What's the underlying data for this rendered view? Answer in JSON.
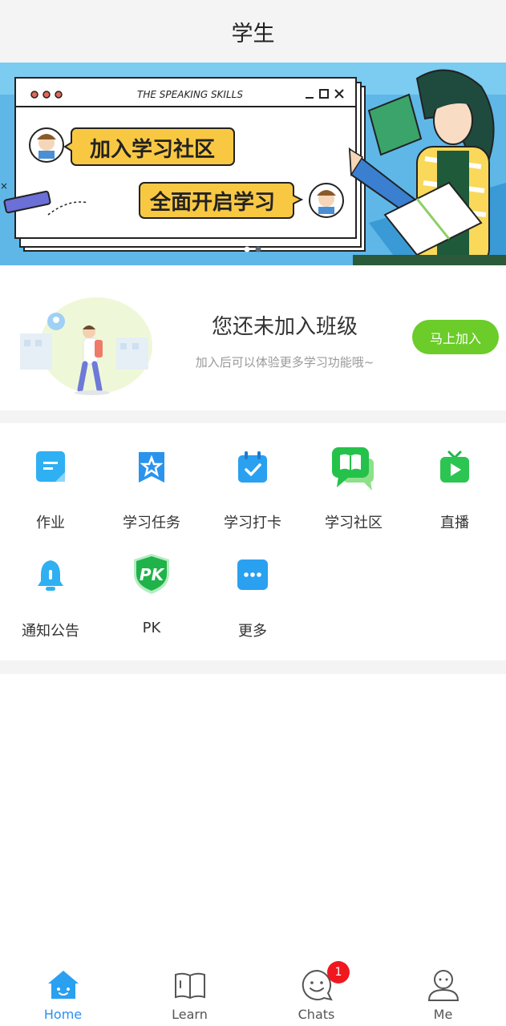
{
  "header": {
    "title": "学生"
  },
  "banner": {
    "window_title": "THE SPEAKING SKILLS",
    "bubble1": "加入学习社区",
    "bubble2": "全面开启学习",
    "slide_index": 1,
    "slide_count": 2
  },
  "promo": {
    "title": "您还未加入班级",
    "subtitle": "加入后可以体验更多学习功能哦~",
    "join_label": "马上加入"
  },
  "features": [
    {
      "label": "作业",
      "icon": "homework-icon"
    },
    {
      "label": "学习任务",
      "icon": "task-star-icon"
    },
    {
      "label": "学习打卡",
      "icon": "calendar-check-icon"
    },
    {
      "label": "学习社区",
      "icon": "community-chat-icon"
    },
    {
      "label": "直播",
      "icon": "live-tv-icon"
    },
    {
      "label": "通知公告",
      "icon": "bell-icon"
    },
    {
      "label": "PK",
      "icon": "pk-shield-icon"
    },
    {
      "label": "更多",
      "icon": "more-icon"
    }
  ],
  "tabs": [
    {
      "label": "Home",
      "icon": "home-icon",
      "active": true
    },
    {
      "label": "Learn",
      "icon": "book-icon",
      "active": false
    },
    {
      "label": "Chats",
      "icon": "chat-smile-icon",
      "active": false,
      "badge": "1"
    },
    {
      "label": "Me",
      "icon": "user-icon",
      "active": false
    }
  ],
  "colors": {
    "accent": "#2a8ff0",
    "join_button": "#6ccc2a",
    "badge": "#f0181f",
    "banner_bg": "#5fb7e8",
    "bubble": "#f9c843"
  }
}
